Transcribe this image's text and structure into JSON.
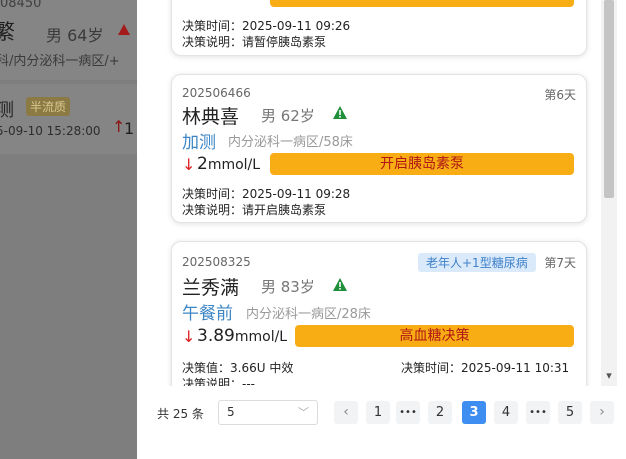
{
  "background": {
    "patient_id_partial": "08450",
    "patient_name_partial": "繁",
    "patient_sex_age": "男  64岁",
    "dept_partial": "科/内分泌科一病区/+",
    "measure_partial": "测",
    "badge": "半流质",
    "time_partial": "5-09-10 15:28:00",
    "value_partial": "1"
  },
  "cards": [
    {
      "decision_time_label": "决策时间：",
      "decision_time": "2025-09-11 09:26",
      "decision_note_label": "决策说明：",
      "decision_note": "请暂停胰岛素泵"
    },
    {
      "patient_id": "202506466",
      "day": "第6天",
      "name": "林典喜",
      "sex_age": "男  62岁",
      "measure_label": "加测",
      "dept": "内分泌科一病区/58床",
      "value": "2",
      "unit": "mmol/L",
      "action": "开启胰岛素泵",
      "decision_time_label": "决策时间：",
      "decision_time": "2025-09-11 09:28",
      "decision_note_label": "决策说明：",
      "decision_note": "请开启胰岛素泵"
    },
    {
      "patient_id": "202508325",
      "tag": "老年人+1型糖尿病",
      "day": "第7天",
      "name": "兰秀满",
      "sex_age": "男  83岁",
      "measure_label": "午餐前",
      "dept": "内分泌科一病区/28床",
      "value": "3.89",
      "unit": "mmol/L",
      "action": "高血糖决策",
      "decision_value_label": "决策值：",
      "decision_value": "3.66U  中效",
      "decision_time_label": "决策时间：",
      "decision_time": "2025-09-11 10:31",
      "decision_note_label": "决策说明：",
      "decision_note": "---"
    }
  ],
  "pagination": {
    "total": "共 25 条",
    "page_size": "5",
    "pages": [
      "1",
      "•••",
      "2",
      "3",
      "4",
      "•••",
      "5"
    ],
    "current": "3"
  },
  "icons": {
    "warning_color": "#1f8f3a",
    "accent_color": "#3d8ef0",
    "button_color": "#f9ad14"
  }
}
